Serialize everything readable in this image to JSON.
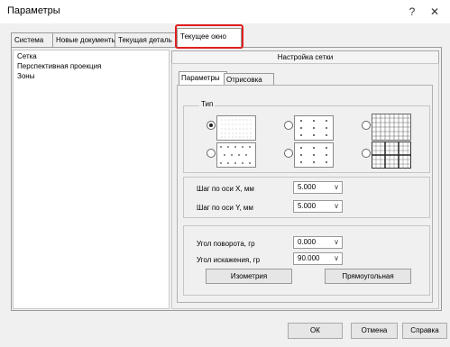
{
  "window": {
    "title": "Параметры",
    "help_glyph": "?",
    "close_glyph": "✕"
  },
  "tabs": [
    {
      "label": "Система"
    },
    {
      "label": "Новые документы"
    },
    {
      "label": "Текущая деталь"
    },
    {
      "label": "Текущее окно",
      "active": true
    }
  ],
  "tree": {
    "items": [
      "Сетка",
      "Перспективная проекция",
      "Зоны"
    ],
    "selected": "Сетка"
  },
  "section_title": "Настройка сетки",
  "inner_tabs": [
    {
      "label": "Параметры",
      "active": true
    },
    {
      "label": "Отрисовка"
    }
  ],
  "type_group": {
    "label": "Тип",
    "options": [
      {
        "icon": "dot-grid-icon",
        "selected": true
      },
      {
        "icon": "dot-grid-coarse-icon",
        "selected": false
      },
      {
        "icon": "line-grid-icon",
        "selected": false
      },
      {
        "icon": "dot-grid-sparse-icon",
        "selected": false
      },
      {
        "icon": "dot-grid-wide-icon",
        "selected": false
      },
      {
        "icon": "line-grid-bold-icon",
        "selected": false
      }
    ]
  },
  "step": {
    "x_label": "Шаг по оси  X, мм",
    "x_value": "5.000",
    "y_label": "Шаг по оси  Y, мм",
    "y_value": "5.000"
  },
  "angles": {
    "rotation_label": "Угол поворота, гр",
    "rotation_value": "0.000",
    "distortion_label": "Угол искажения, гр",
    "distortion_value": "90.000"
  },
  "buttons": {
    "isometry": "Изометрия",
    "rectangular": "Прямоугольная",
    "ok": "ОК",
    "cancel": "Отмена",
    "help": "Справка"
  },
  "colors": {
    "highlight": "#e02020"
  }
}
